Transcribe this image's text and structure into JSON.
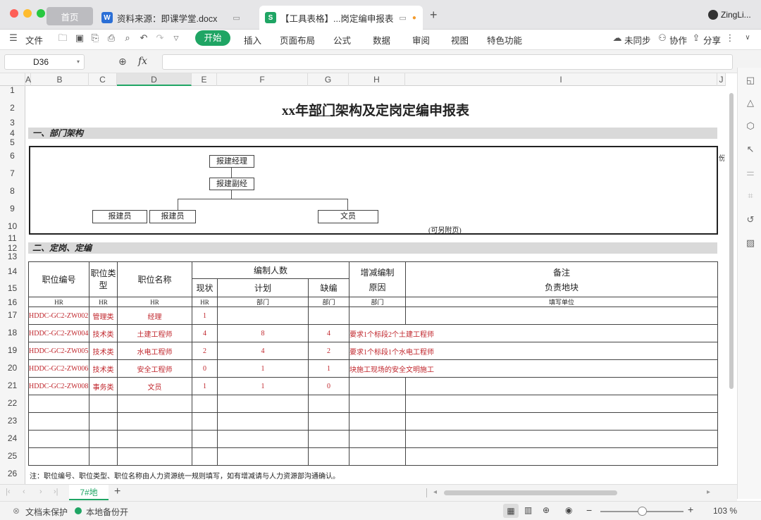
{
  "titlebar": {
    "tabs": [
      {
        "label": "首页"
      },
      {
        "label": "资料来源：即课学堂.docx",
        "icon_letter": "W"
      },
      {
        "label": "【工具表格】...岗定编申报表",
        "icon_letter": "S"
      }
    ],
    "new_tab": "+",
    "user": "ZingLi..."
  },
  "ribbon": {
    "file": "文件",
    "start": "开始",
    "menus": [
      "插入",
      "页面布局",
      "公式",
      "数据",
      "审阅",
      "视图",
      "特色功能"
    ],
    "sync": "未同步",
    "collab": "协作",
    "share": "分享"
  },
  "formula_bar": {
    "cell_ref": "D36",
    "fx": "fx",
    "value": ""
  },
  "columns": [
    "A",
    "B",
    "C",
    "D",
    "E",
    "F",
    "G",
    "H",
    "I",
    "J"
  ],
  "rows": [
    "1",
    "2",
    "3",
    "4",
    "5",
    "6",
    "7",
    "8",
    "9",
    "10",
    "11",
    "12",
    "13",
    "14",
    "15",
    "16",
    "17",
    "18",
    "19",
    "20",
    "21",
    "22",
    "23",
    "24",
    "25",
    "26"
  ],
  "sheet": {
    "title_pre": "xx年",
    "title_u": "部门",
    "title_post": "架构及定岗定编申报表",
    "section1": "一、部门架构",
    "org": {
      "manager": "报建经理",
      "deputy": "报建副经",
      "staff1": "报建员",
      "staff2": "报建员",
      "clerk": "文员",
      "note": "(可另附页)",
      "cut_text": "份"
    },
    "section2": "二、定岗、定编",
    "headers": {
      "job_no": "职位编号",
      "job_type": "职位类型",
      "job_name": "职位名称",
      "staffing": "编制人数",
      "current": "现状",
      "plan": "计划",
      "shortage": "缺编",
      "change_reason_1": "增减编制",
      "change_reason_2": "原因",
      "remark_1": "备注",
      "remark_2": "负责地块"
    },
    "subheaders": [
      "HR",
      "HR",
      "HR",
      "HR",
      "部门",
      "部门",
      "部门",
      "填写单位"
    ],
    "data_rows": [
      {
        "no": "HDDC-GC2-ZW002",
        "type": "管理类",
        "name": "经理",
        "cur": "1",
        "plan": "",
        "short": "",
        "reason": "",
        "remark": ""
      },
      {
        "no": "HDDC-GC2-ZW004",
        "type": "技术类",
        "name": "土建工程师",
        "cur": "4",
        "plan": "8",
        "short": "4",
        "reason": "要求1个标段2个土建工程师",
        "remark": ""
      },
      {
        "no": "HDDC-GC2-ZW005",
        "type": "技术类",
        "name": "水电工程师",
        "cur": "2",
        "plan": "4",
        "short": "2",
        "reason": "要求1个标段1个水电工程师",
        "remark": ""
      },
      {
        "no": "HDDC-GC2-ZW006",
        "type": "技术类",
        "name": "安全工程师",
        "cur": "0",
        "plan": "1",
        "short": "1",
        "reason": "块施工现场的安全文明施工",
        "remark": ""
      },
      {
        "no": "HDDC-GC2-ZW008",
        "type": "事务类",
        "name": "文员",
        "cur": "1",
        "plan": "1",
        "short": "0",
        "reason": "",
        "remark": ""
      }
    ],
    "footnote": "注：职位编号、职位类型、职位名称由人力资源统一规则填写，如有增减请与人力资源部沟通确认。"
  },
  "sheet_tab": "7#地",
  "status": {
    "protect": "文档未保护",
    "backup": "本地备份开",
    "zoom": "103 %"
  },
  "colors": {
    "accent": "#1fa564",
    "red_text": "#c0262c",
    "section_bar": "#d9d9d9"
  }
}
